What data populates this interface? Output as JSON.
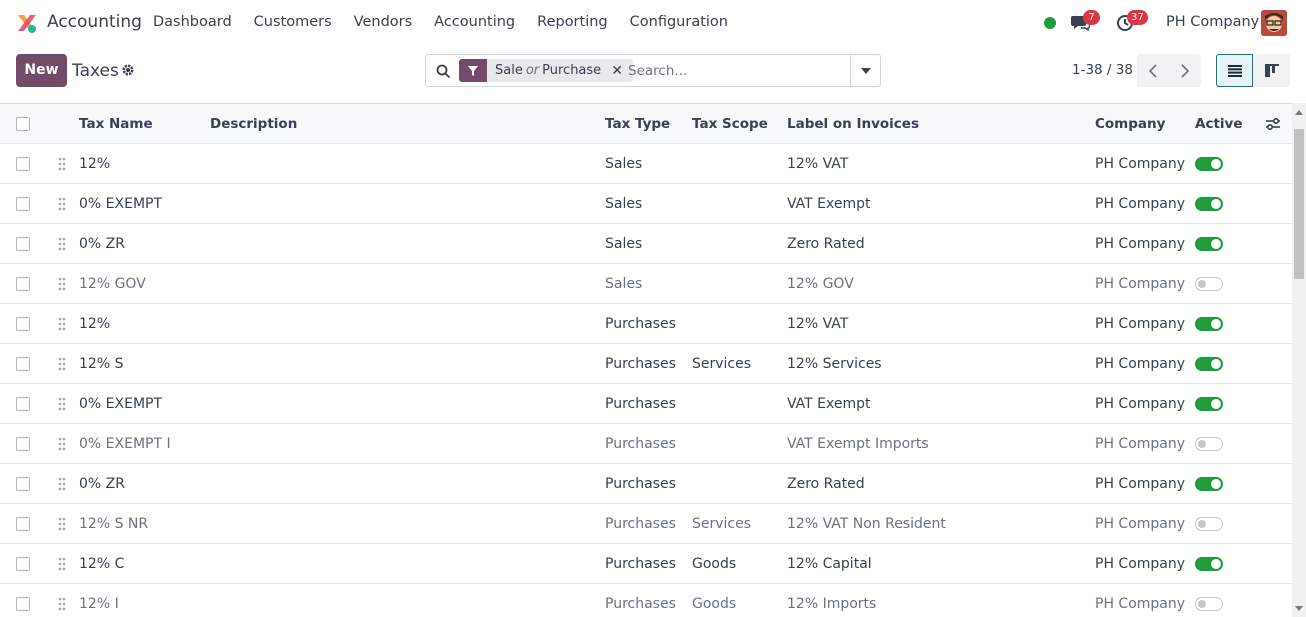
{
  "navbar": {
    "app_name": "Accounting",
    "menu": [
      "Dashboard",
      "Customers",
      "Vendors",
      "Accounting",
      "Reporting",
      "Configuration"
    ],
    "messages_count": "7",
    "activities_count": "37",
    "company": "PH Company"
  },
  "control": {
    "new_label": "New",
    "title": "Taxes",
    "facet_first": "Sale",
    "facet_or": "or",
    "facet_second": "Purchase",
    "search_placeholder": "Search...",
    "pager": "1-38 / 38"
  },
  "table": {
    "headers": {
      "tax_name": "Tax Name",
      "description": "Description",
      "tax_type": "Tax Type",
      "tax_scope": "Tax Scope",
      "label": "Label on Invoices",
      "company": "Company",
      "active": "Active"
    },
    "rows": [
      {
        "name": "12%",
        "description": "",
        "type": "Sales",
        "scope": "",
        "label": "12% VAT",
        "company": "PH Company",
        "active": true
      },
      {
        "name": "0% EXEMPT",
        "description": "",
        "type": "Sales",
        "scope": "",
        "label": "VAT Exempt",
        "company": "PH Company",
        "active": true
      },
      {
        "name": "0% ZR",
        "description": "",
        "type": "Sales",
        "scope": "",
        "label": "Zero Rated",
        "company": "PH Company",
        "active": true
      },
      {
        "name": "12% GOV",
        "description": "",
        "type": "Sales",
        "scope": "",
        "label": "12% GOV",
        "company": "PH Company",
        "active": false
      },
      {
        "name": "12%",
        "description": "",
        "type": "Purchases",
        "scope": "",
        "label": "12% VAT",
        "company": "PH Company",
        "active": true
      },
      {
        "name": "12% S",
        "description": "",
        "type": "Purchases",
        "scope": "Services",
        "label": "12% Services",
        "company": "PH Company",
        "active": true
      },
      {
        "name": "0% EXEMPT",
        "description": "",
        "type": "Purchases",
        "scope": "",
        "label": "VAT Exempt",
        "company": "PH Company",
        "active": true
      },
      {
        "name": "0% EXEMPT I",
        "description": "",
        "type": "Purchases",
        "scope": "",
        "label": "VAT Exempt Imports",
        "company": "PH Company",
        "active": false
      },
      {
        "name": "0% ZR",
        "description": "",
        "type": "Purchases",
        "scope": "",
        "label": "Zero Rated",
        "company": "PH Company",
        "active": true
      },
      {
        "name": "12% S NR",
        "description": "",
        "type": "Purchases",
        "scope": "Services",
        "label": "12% VAT Non Resident",
        "company": "PH Company",
        "active": false
      },
      {
        "name": "12% C",
        "description": "",
        "type": "Purchases",
        "scope": "Goods",
        "label": "12% Capital",
        "company": "PH Company",
        "active": true
      },
      {
        "name": "12% I",
        "description": "",
        "type": "Purchases",
        "scope": "Goods",
        "label": "12% Imports",
        "company": "PH Company",
        "active": false
      }
    ]
  },
  "colors": {
    "brand": "#714B67",
    "toggle_on": "#1f9d3a",
    "badge": "#dc3545",
    "status_online": "#1f9d3a"
  },
  "icons": [
    "app-logo-icon",
    "chat-icon",
    "clock-icon",
    "gear-icon",
    "search-icon",
    "filter-icon",
    "close-icon",
    "chevron-down-icon",
    "chevron-left-icon",
    "chevron-right-icon",
    "list-view-icon",
    "kanban-view-icon",
    "drag-handle-icon",
    "optional-columns-icon"
  ]
}
